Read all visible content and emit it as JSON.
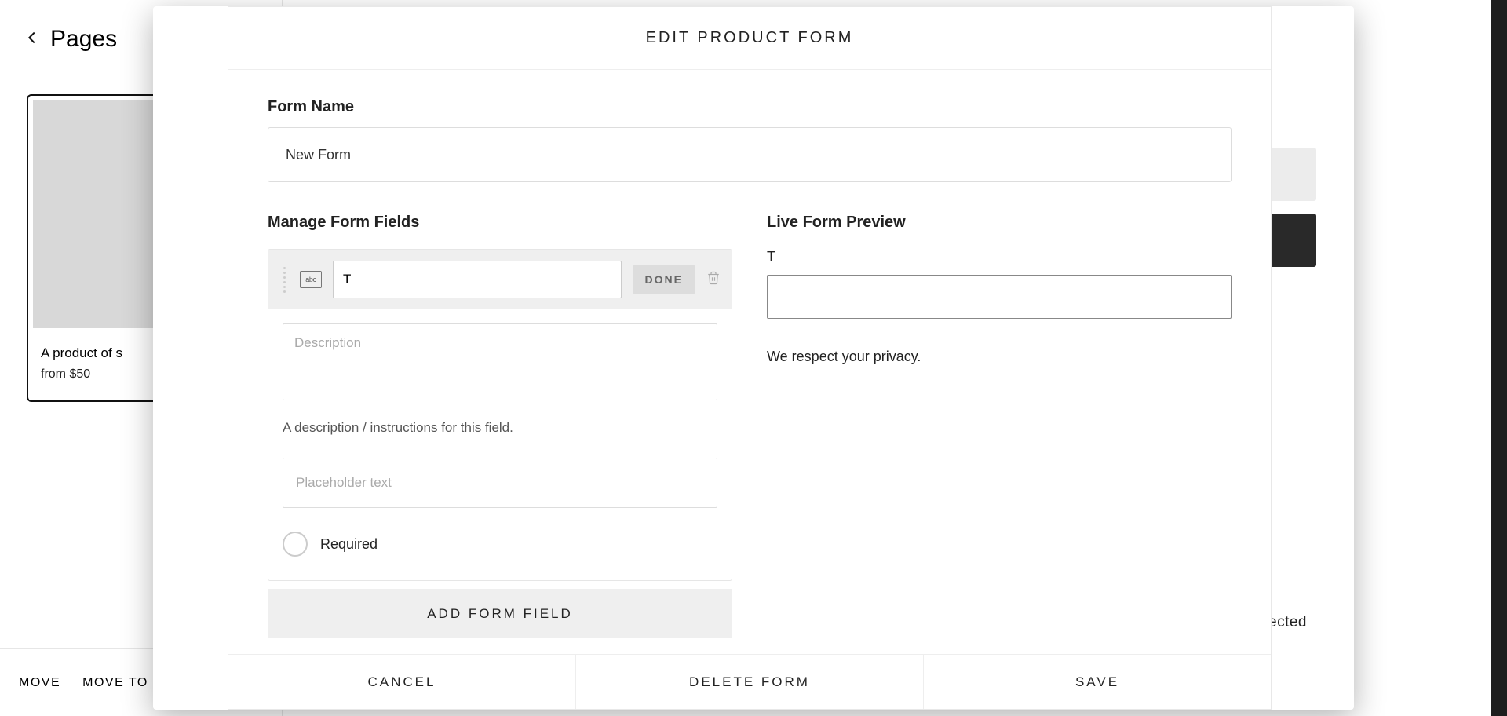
{
  "sidebar": {
    "back_label": "Pages",
    "product": {
      "title": "A product of s",
      "price_line": "from $50"
    },
    "footer": {
      "move": "MOVE",
      "move_to": "MOVE TO"
    }
  },
  "overlay": {
    "selected_text": "item selected"
  },
  "modal": {
    "title": "EDIT PRODUCT FORM",
    "form_name_label": "Form Name",
    "form_name_value": "New Form",
    "left_heading": "Manage Form Fields",
    "right_heading": "Live Form Preview",
    "field": {
      "type_icon_text": "abc",
      "name_value": "T",
      "done_label": "DONE",
      "desc_placeholder": "Description",
      "desc_hint": "A description / instructions for this field.",
      "placeholder_placeholder": "Placeholder text",
      "required_label": "Required"
    },
    "add_field_label": "ADD FORM FIELD",
    "preview": {
      "field_label": "T",
      "privacy_note": "We respect your privacy."
    },
    "footer": {
      "cancel": "CANCEL",
      "delete": "DELETE FORM",
      "save": "SAVE"
    }
  }
}
